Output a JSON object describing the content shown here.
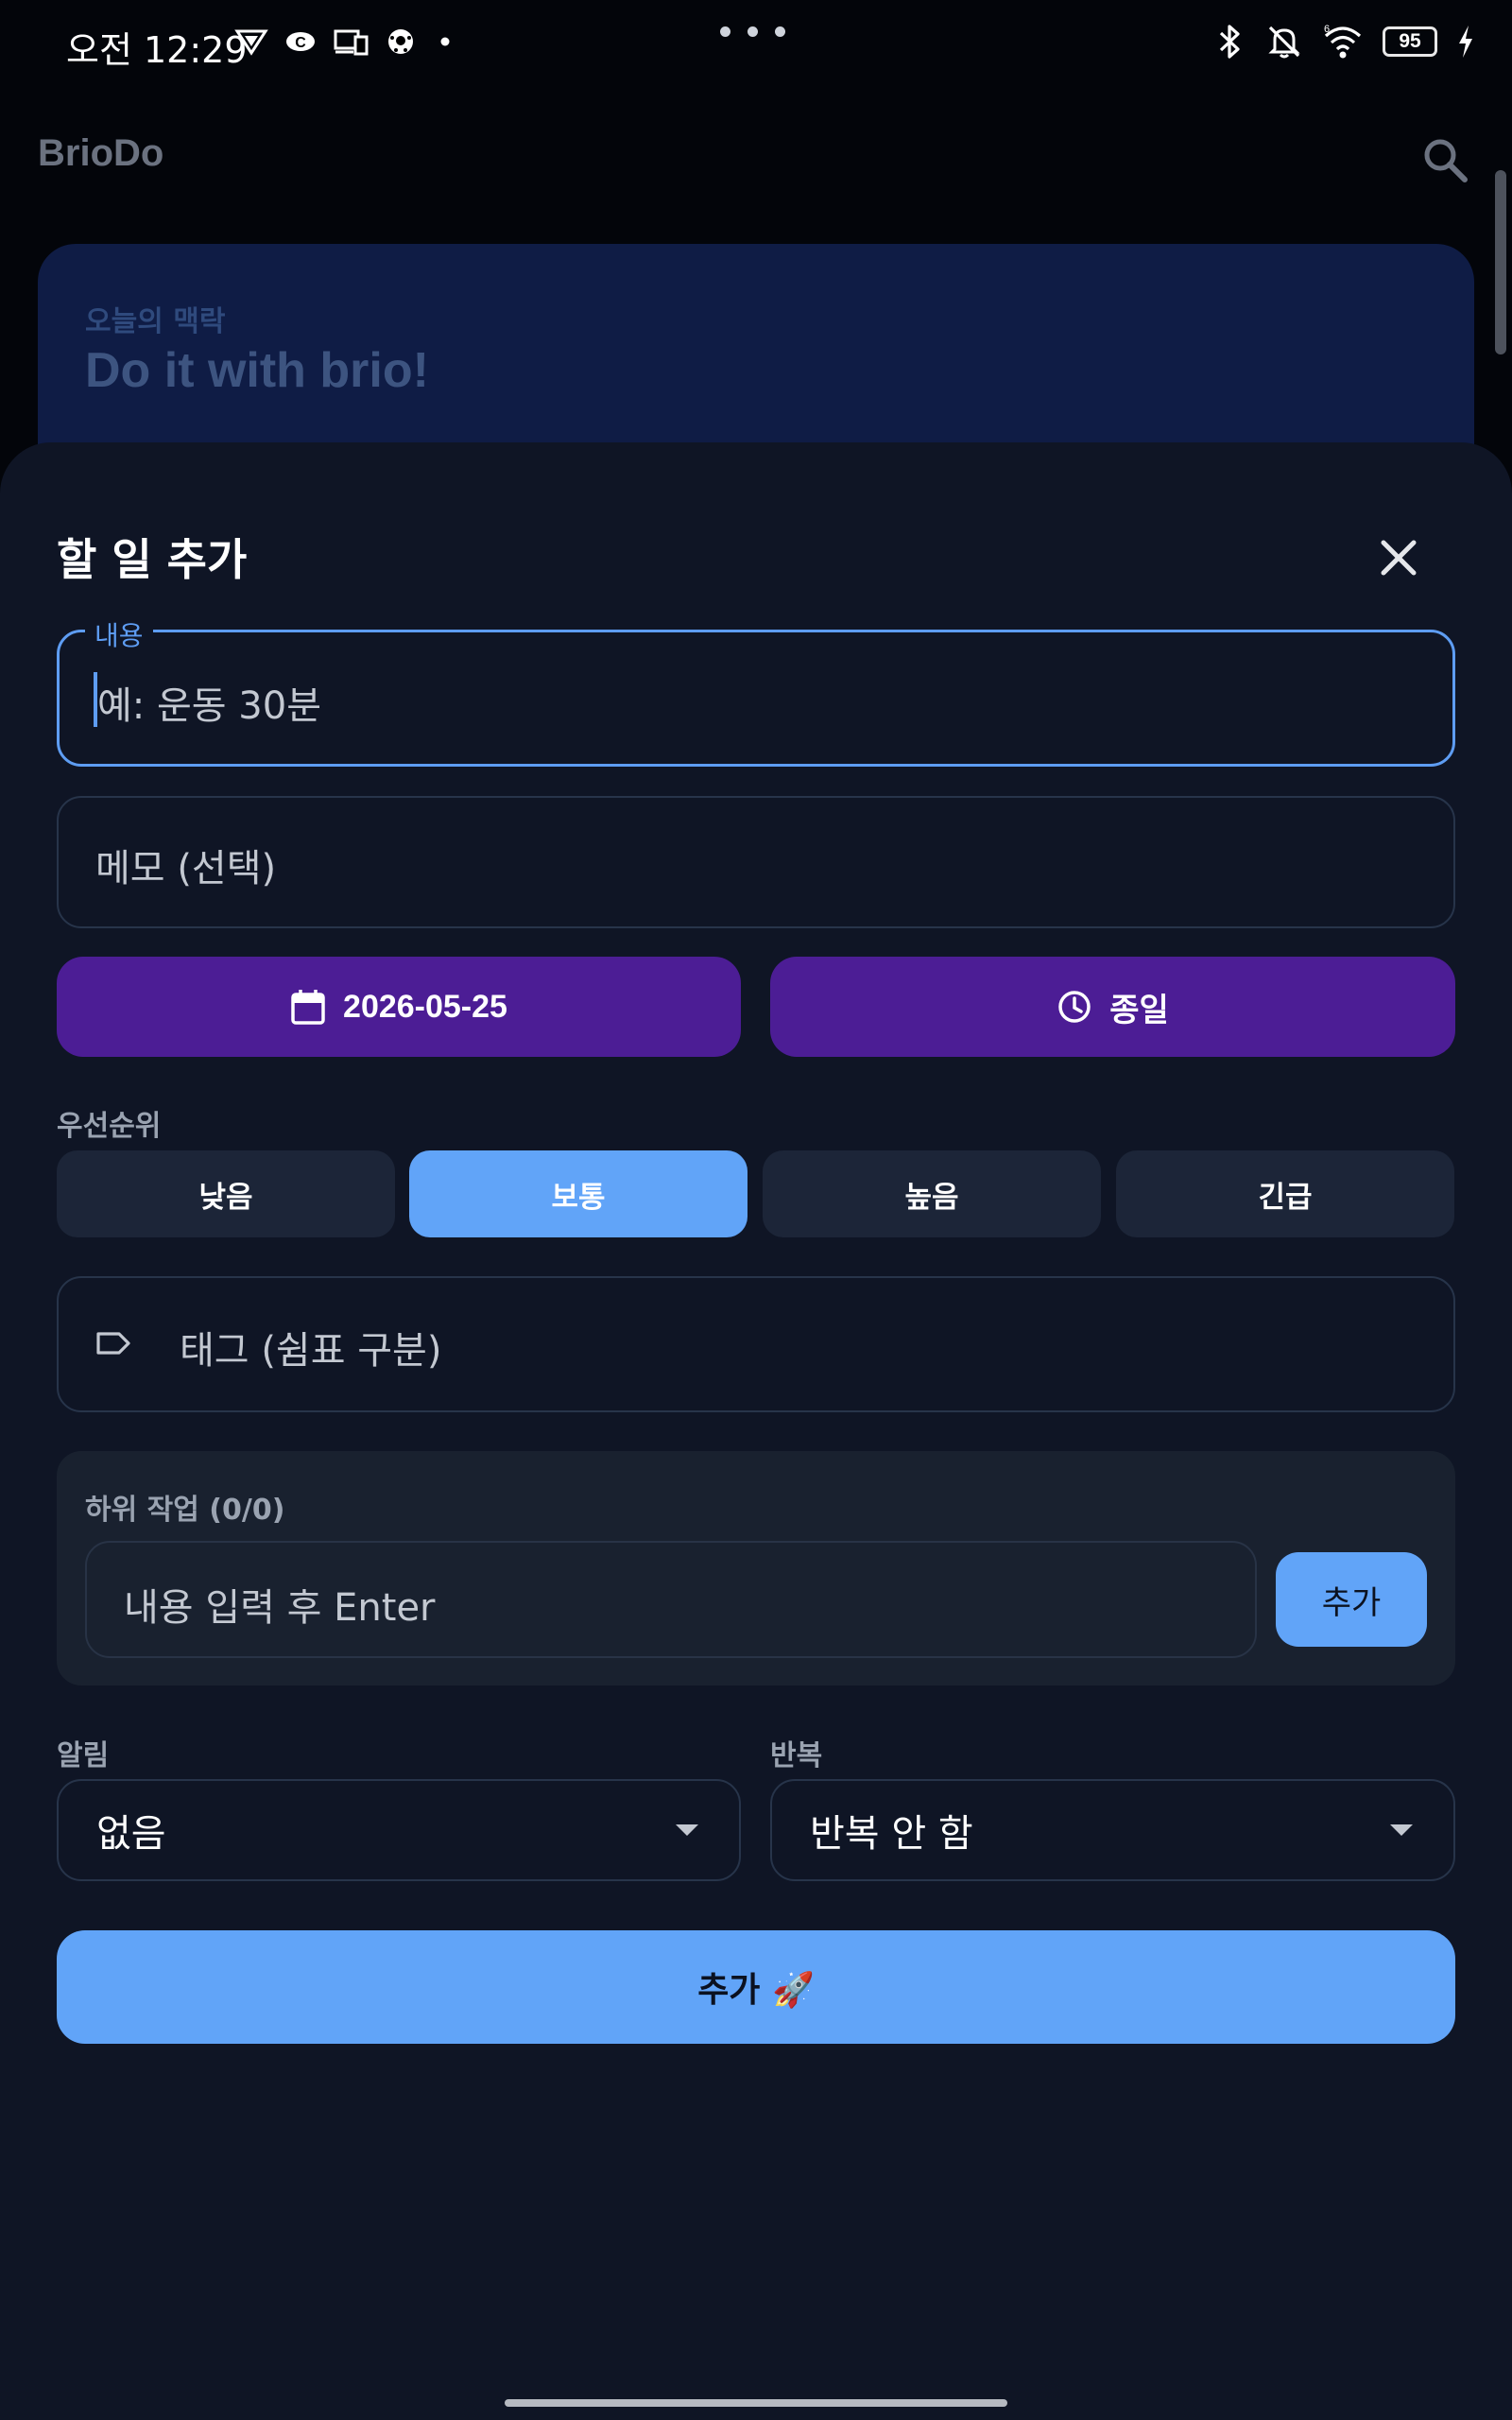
{
  "status_bar": {
    "time": "오전 12:29",
    "battery": "95"
  },
  "app": {
    "title": "BrioDo"
  },
  "hero": {
    "subtitle": "오늘의 맥락",
    "title": "Do it with brio!"
  },
  "sheet": {
    "title": "할 일 추가",
    "content_label": "내용",
    "content_placeholder": "예: 운동 30분",
    "memo_placeholder": "메모 (선택)",
    "date_label": "2026-05-25",
    "time_label": "종일",
    "priority_label": "우선순위",
    "priorities": [
      {
        "label": "낮음",
        "active": false
      },
      {
        "label": "보통",
        "active": true
      },
      {
        "label": "높음",
        "active": false
      },
      {
        "label": "긴급",
        "active": false
      }
    ],
    "tags_placeholder": "태그 (쉼표 구분)",
    "subtasks": {
      "title": "하위 작업 (0/0)",
      "input_placeholder": "내용 입력 후 Enter",
      "add_label": "추가"
    },
    "alarm": {
      "label": "알림",
      "value": "없음"
    },
    "repeat": {
      "label": "반복",
      "value": "반복 안 함"
    },
    "submit_label": "추가 🚀"
  },
  "colors": {
    "accent": "#61a4f8",
    "date_button": "#4c1d95",
    "sheet_bg": "#0f1525"
  },
  "icons": [
    "search-icon",
    "close-icon",
    "calendar-icon",
    "clock-icon",
    "tag-icon",
    "dropdown-arrow-icon",
    "bluetooth-icon",
    "bell-off-icon",
    "wifi-icon",
    "battery-icon",
    "charging-icon"
  ]
}
